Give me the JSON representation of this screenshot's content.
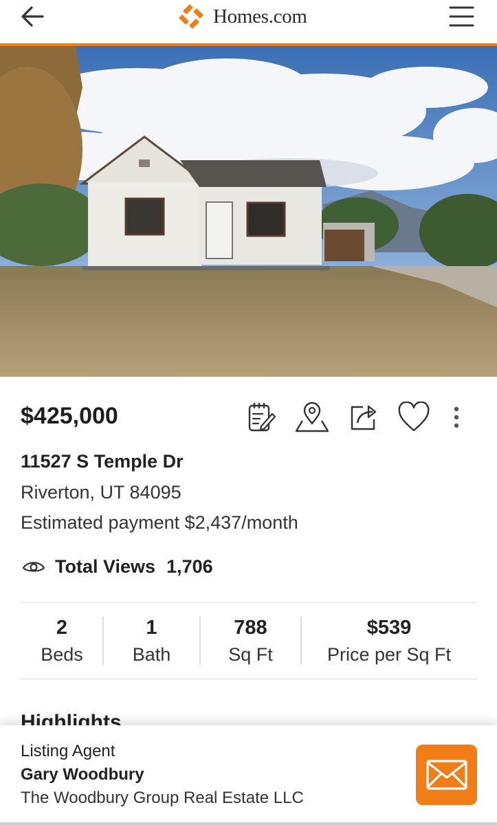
{
  "colors": {
    "accent": "#f07d18",
    "text": "#222222",
    "divider": "#dcdcdc"
  },
  "header": {
    "back_icon": "arrow-left-icon",
    "brand": "Homes.com",
    "menu_icon": "hamburger-menu-icon"
  },
  "listing": {
    "photo": "house-exterior-photo",
    "price": "$425,000",
    "actions": [
      {
        "name": "notes-button",
        "icon": "notepad-pencil-icon"
      },
      {
        "name": "map-location-button",
        "icon": "map-pin-icon"
      },
      {
        "name": "share-button",
        "icon": "share-arrow-icon"
      },
      {
        "name": "favorite-button",
        "icon": "heart-icon"
      },
      {
        "name": "more-options-button",
        "icon": "vertical-ellipsis-icon"
      }
    ],
    "street": "11527 S Temple Dr",
    "city_state_zip": "Riverton, UT 84095",
    "estimated_payment": "Estimated payment $2,437/month",
    "views_label": "Total Views",
    "views_count": "1,706",
    "stats": [
      {
        "value": "2",
        "label": "Beds"
      },
      {
        "value": "1",
        "label": "Bath"
      },
      {
        "value": "788",
        "label": "Sq Ft"
      },
      {
        "value": "$539",
        "label": "Price per Sq Ft"
      }
    ],
    "highlights_heading": "Highlights"
  },
  "footer": {
    "role": "Listing Agent",
    "agent_name": "Gary Woodbury",
    "brokerage": "The Woodbury Group Real Estate LLC",
    "contact_icon": "envelope-icon"
  }
}
